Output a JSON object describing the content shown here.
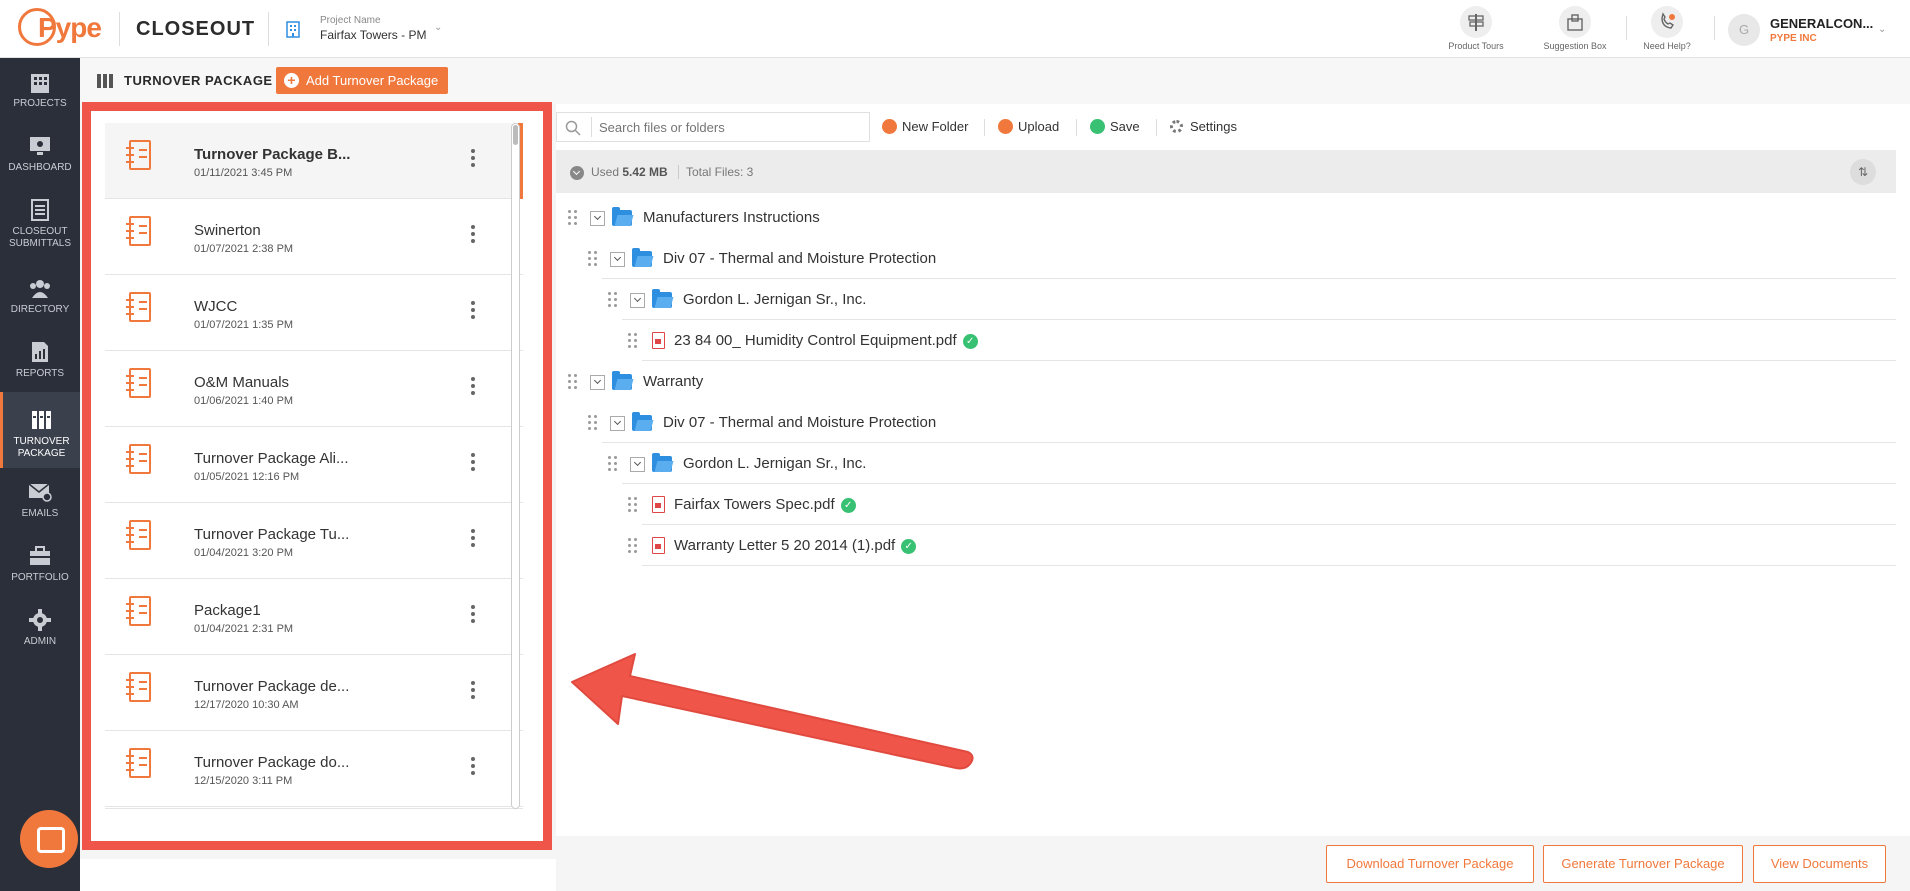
{
  "header": {
    "logo_text": "Pype",
    "brand": "CLOSEOUT",
    "project_label": "Project Name",
    "project_name": "Fairfax Towers - PM",
    "tools": [
      {
        "label": "Product Tours",
        "icon": "signpost-icon"
      },
      {
        "label": "Suggestion Box",
        "icon": "suggestion-box-icon"
      },
      {
        "label": "Need Help?",
        "icon": "help-phone-icon"
      }
    ],
    "user": {
      "initial": "G",
      "name": "GENERALCON...",
      "company": "PYPE INC"
    }
  },
  "sidebar": {
    "items": [
      {
        "label": "PROJECTS",
        "icon": "building-icon"
      },
      {
        "label": "DASHBOARD",
        "icon": "monitor-icon"
      },
      {
        "label": "CLOSEOUT SUBMITTALS",
        "icon": "document-list-icon"
      },
      {
        "label": "DIRECTORY",
        "icon": "people-icon"
      },
      {
        "label": "REPORTS",
        "icon": "report-chart-icon"
      },
      {
        "label": "TURNOVER PACKAGE",
        "icon": "binders-icon",
        "active": true
      },
      {
        "label": "EMAILS",
        "icon": "envelope-icon"
      },
      {
        "label": "PORTFOLIO",
        "icon": "briefcase-icon"
      },
      {
        "label": "ADMIN",
        "icon": "gear-icon"
      }
    ]
  },
  "section": {
    "title": "TURNOVER PACKAGE",
    "add_button": "Add Turnover Package"
  },
  "packages": [
    {
      "name": "Turnover Package B...",
      "date": "01/11/2021 3:45 PM"
    },
    {
      "name": "Swinerton",
      "date": "01/07/2021 2:38 PM"
    },
    {
      "name": "WJCC",
      "date": "01/07/2021 1:35 PM"
    },
    {
      "name": "O&M Manuals",
      "date": "01/06/2021 1:40 PM"
    },
    {
      "name": "Turnover Package Ali...",
      "date": "01/05/2021 12:16 PM"
    },
    {
      "name": "Turnover Package Tu...",
      "date": "01/04/2021 3:20 PM"
    },
    {
      "name": "Package1",
      "date": "01/04/2021 2:31 PM"
    },
    {
      "name": "Turnover Package de...",
      "date": "12/17/2020 10:30 AM"
    },
    {
      "name": "Turnover Package do...",
      "date": "12/15/2020 3:11 PM"
    }
  ],
  "toolbar": {
    "search_placeholder": "Search files or folders",
    "new_folder": "New Folder",
    "upload": "Upload",
    "save": "Save",
    "settings": "Settings"
  },
  "storage": {
    "used_label": "Used",
    "used_value": "5.42 MB",
    "total_files": "Total Files: 3"
  },
  "tree": [
    {
      "type": "folder",
      "name": "Manufacturers Instructions",
      "level": 0
    },
    {
      "type": "folder",
      "name": "Div 07 - Thermal and Moisture Protection",
      "level": 1
    },
    {
      "type": "folder",
      "name": "Gordon L. Jernigan Sr., Inc.",
      "level": 2
    },
    {
      "type": "file",
      "name": "23 84 00_ Humidity Control Equipment.pdf",
      "level": 3,
      "verified": true
    },
    {
      "type": "folder",
      "name": "Warranty",
      "level": 0
    },
    {
      "type": "folder",
      "name": "Div 07 - Thermal and Moisture Protection",
      "level": 1
    },
    {
      "type": "folder",
      "name": "Gordon L. Jernigan Sr., Inc.",
      "level": 2
    },
    {
      "type": "file",
      "name": "Fairfax Towers Spec.pdf",
      "level": 3,
      "verified": true
    },
    {
      "type": "file",
      "name": "Warranty Letter 5 20 2014 (1).pdf",
      "level": 3,
      "verified": true
    }
  ],
  "footer": {
    "download": "Download Turnover Package",
    "generate": "Generate Turnover Package",
    "view": "View Documents"
  },
  "colors": {
    "accent": "#f0783c",
    "sidebar": "#2a2f3a",
    "highlight": "#f05549",
    "folder": "#2e8ee0",
    "verified": "#38c172"
  }
}
